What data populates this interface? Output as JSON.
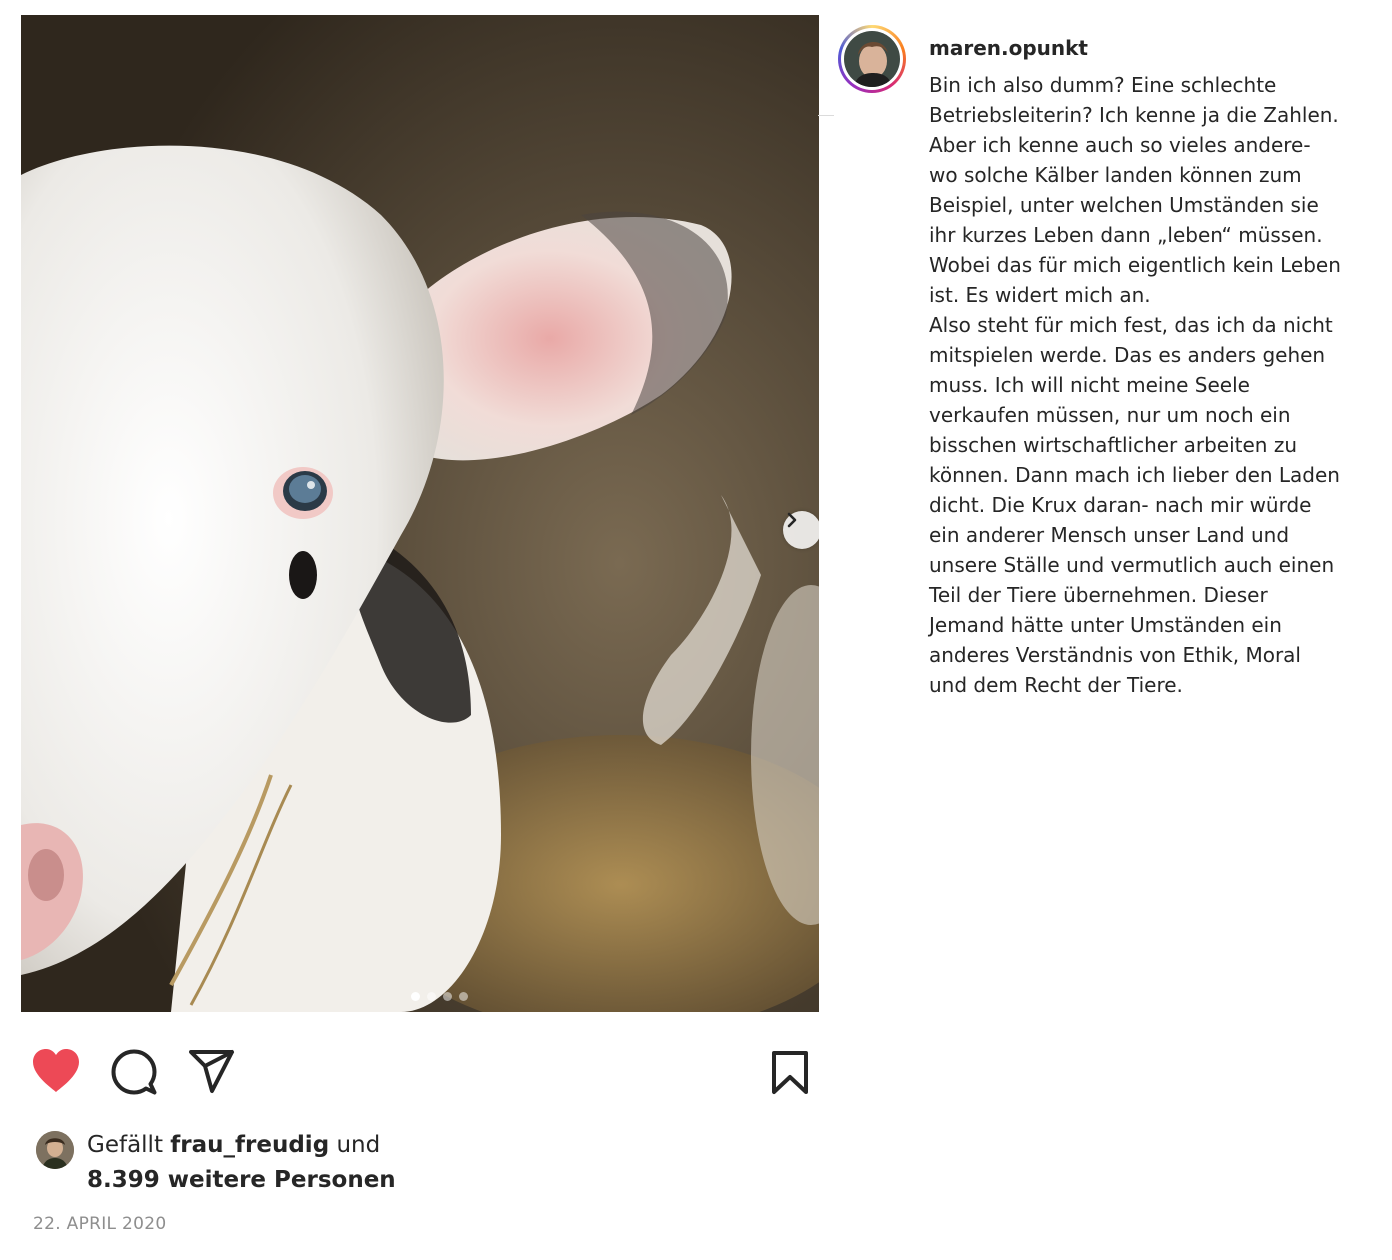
{
  "post": {
    "username": "maren.opunkt",
    "caption_lines": [
      "Bin ich also dumm? Eine schlechte",
      "Betriebsleiterin? Ich kenne ja die Zahlen.",
      "Aber ich kenne auch so vieles andere-",
      "wo solche Kälber landen können zum",
      "Beispiel, unter welchen Umständen sie",
      "ihr kurzes Leben dann „leben“ müssen.",
      "Wobei das für mich eigentlich kein Leben",
      "ist. Es widert mich an.",
      "Also steht für mich fest, das ich da nicht",
      "mitspielen werde. Das es anders gehen",
      "muss. Ich will nicht meine Seele",
      "verkaufen müssen, nur um noch ein",
      "bisschen wirtschaftlicher arbeiten zu",
      "können. Dann mach ich lieber den Laden",
      "dicht. Die Krux daran- nach mir würde",
      "ein anderer Mensch unser Land und",
      "unsere Ställe und vermutlich auch einen",
      "Teil der Tiere übernehmen. Dieser",
      "Jemand hätte unter Umständen ein",
      "anderes Verständnis von Ethik, Moral",
      "und dem Recht der Tiere."
    ],
    "carousel": {
      "total": 4,
      "active_index": 0
    },
    "likes": {
      "prefix": "Gefällt",
      "first_liker": "frau_freudig",
      "connector": "und",
      "others": "8.399 weitere Personen"
    },
    "date": "22. APRIL 2020"
  },
  "icons": {
    "like": "heart-icon",
    "comment": "comment-bubble-icon",
    "share": "paper-plane-icon",
    "save": "bookmark-icon",
    "next": "chevron-right-icon"
  },
  "colors": {
    "like_active": "#ed4956",
    "text": "#262626",
    "muted": "#8e8e8e"
  }
}
